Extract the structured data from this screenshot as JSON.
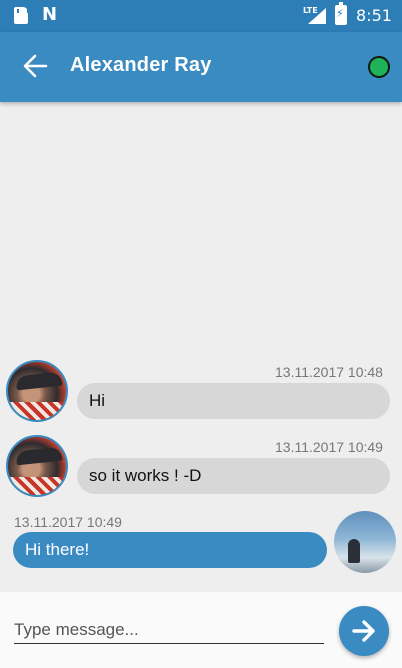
{
  "status_bar": {
    "network": "LTE",
    "time": "8:51"
  },
  "header": {
    "title": "Alexander Ray",
    "back_icon": "arrow-left-icon",
    "status_icon": "online-dot-icon",
    "accent_color": "#3a8bc1"
  },
  "messages": [
    {
      "sender": "them",
      "timestamp": "13.11.2017 10:48",
      "text": "Hi"
    },
    {
      "sender": "them",
      "timestamp": "13.11.2017 10:49",
      "text": "so it works ! -D"
    },
    {
      "sender": "me",
      "timestamp": "13.11.2017 10:49",
      "text": "Hi there!"
    }
  ],
  "composer": {
    "placeholder": "Type message...",
    "value": "",
    "send_icon": "arrow-right-icon"
  }
}
